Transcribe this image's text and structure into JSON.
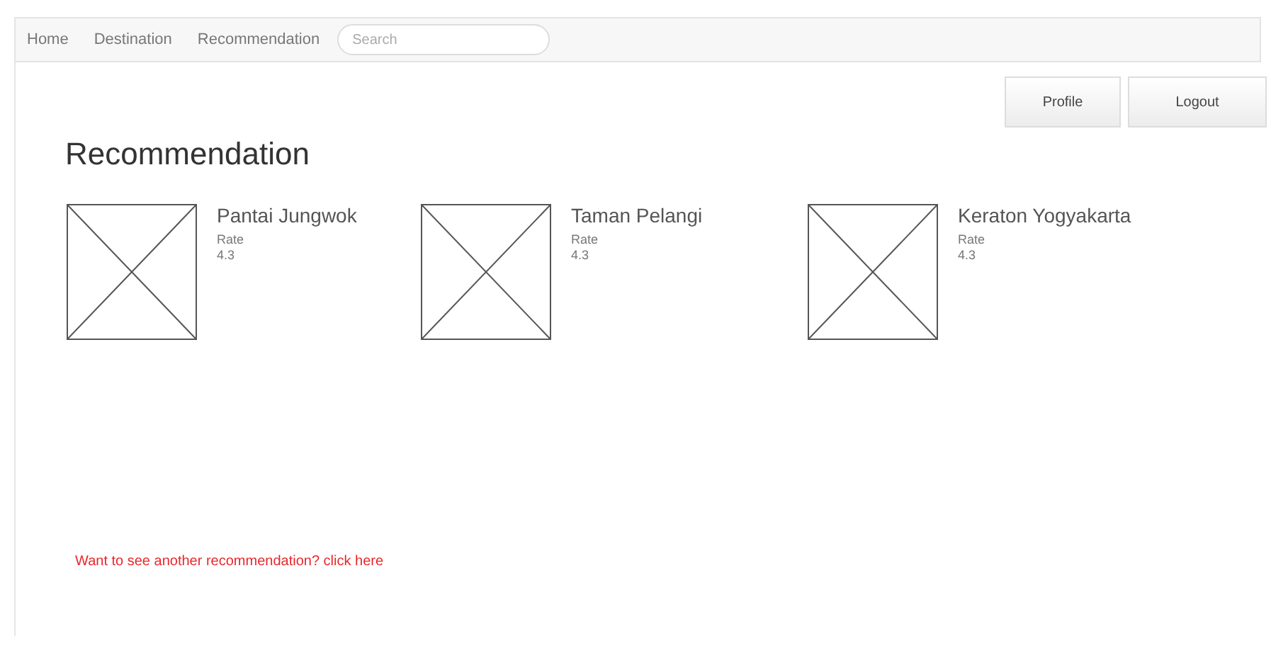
{
  "nav": {
    "links": [
      "Home",
      "Destination",
      "Recommendation"
    ],
    "search": {
      "placeholder": "Search"
    }
  },
  "buttons": [
    "Profile",
    "Logout"
  ],
  "heading": "Recommendation",
  "items": [
    {
      "title": "Pantai Jungwok",
      "rate_label": "Rate",
      "rate": "4.3"
    },
    {
      "title": "Taman Pelangi",
      "rate_label": "Rate",
      "rate": "4.3"
    },
    {
      "title": "Keraton Yogyakarta",
      "rate_label": "Rate",
      "rate": "4.3"
    }
  ],
  "footer_link": "Want to see another recommendation? click here"
}
